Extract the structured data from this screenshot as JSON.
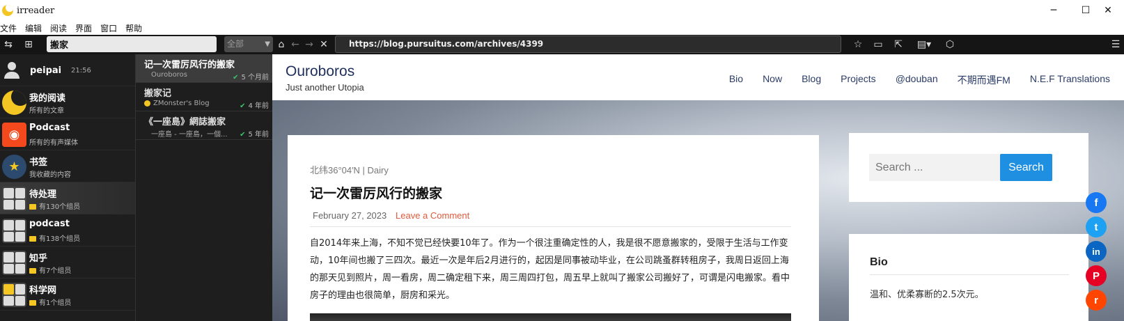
{
  "window": {
    "title": "irreader",
    "minimize": "─",
    "maximize": "☐",
    "close": "✕"
  },
  "menu": [
    "文件",
    "编辑",
    "阅读",
    "界面",
    "窗口",
    "帮助"
  ],
  "toolbar": {
    "search_value": "搬家",
    "filter_value": "全部",
    "url": "https://blog.pursuitus.com/archives/4399"
  },
  "sidebar": {
    "user": {
      "name": "peipai",
      "time": "21:56"
    },
    "items": [
      {
        "title": "我的阅读",
        "sub": "所有的文章"
      },
      {
        "title": "Podcast",
        "sub": "所有的有声媒体"
      },
      {
        "title": "书签",
        "sub": "我收藏的内容"
      },
      {
        "title": "待处理",
        "sub": "有130个组员"
      },
      {
        "title": "podcast",
        "sub": "有138个组员"
      },
      {
        "title": "知乎",
        "sub": "有7个组员"
      },
      {
        "title": "科学网",
        "sub": "有1个组员"
      }
    ]
  },
  "articles": [
    {
      "title": "记一次雷厉风行的搬家",
      "source": "Ouroboros",
      "time": "5 个月前"
    },
    {
      "title": "搬家记",
      "source": "ZMonster's Blog",
      "time": "4 年前"
    },
    {
      "title": "《一座島》網誌搬家",
      "source": "一座島 - 一座島，一個...",
      "time": "5 年前"
    }
  ],
  "site": {
    "title": "Ouroboros",
    "tagline": "Just another Utopia",
    "nav": [
      "Bio",
      "Now",
      "Blog",
      "Projects",
      "@douban",
      "不期而遇FM",
      "N.E.F Translations"
    ]
  },
  "post": {
    "category": "北纬36°04′N | Dairy",
    "title": "记一次雷厉风行的搬家",
    "date": "February 27, 2023",
    "comment": "Leave a Comment",
    "body": "自2014年来上海，不知不觉已经快要10年了。作为一个很注重确定性的人，我是很不愿意搬家的，受限于生活与工作变动，10年间也搬了三四次。最近一次是年后2月进行的，起因是同事被动毕业，在公司跳蚤群转租房子，我周日返回上海的那天见到照片，周一看房，周二确定租下来，周三周四打包，周五早上就叫了搬家公司搬好了，可谓是闪电搬家。看中房子的理由也很简单，厨房和采光。"
  },
  "widget": {
    "search_placeholder": "Search ...",
    "search_button": "Search",
    "bio_title": "Bio",
    "bio_text": "温和、优柔寡断的2.5次元。"
  },
  "share": {
    "facebook": "f",
    "twitter": "t",
    "linkedin": "in",
    "pinterest": "P",
    "reddit": "r"
  },
  "colors": {
    "accent": "#1e8fe1",
    "comment": "#e05a3b",
    "check": "#3bc46b",
    "folder": "#f3c623"
  }
}
